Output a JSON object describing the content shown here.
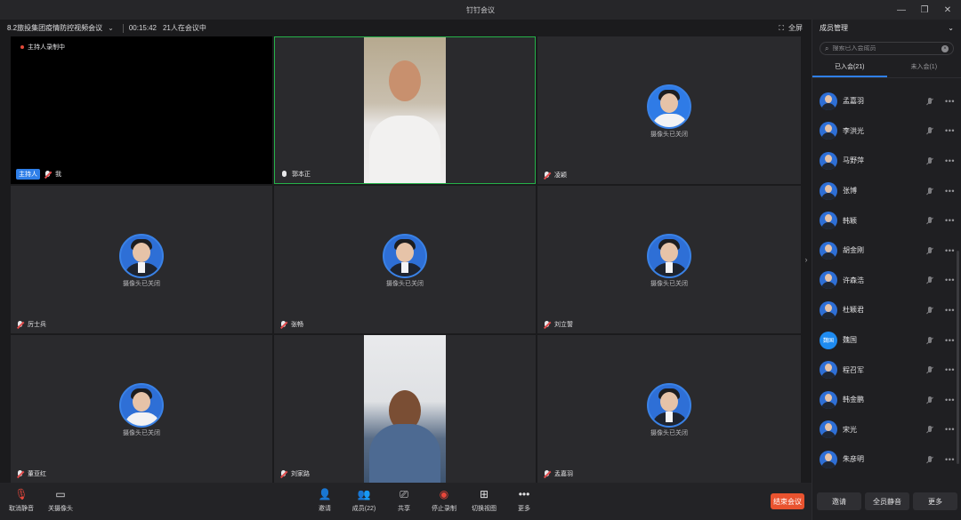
{
  "window": {
    "title": "钉钉会议"
  },
  "meeting": {
    "title": "8.2旅投集团疫情防控视频会议",
    "timer": "00:15:42",
    "count": "21人在会议中",
    "fullscreen": "全屏"
  },
  "tiles": {
    "t1": {
      "rec": "主持人录制中",
      "host": "主持人",
      "name": "我"
    },
    "t2": {
      "name": "郭本正"
    },
    "t3": {
      "name": "凌颖",
      "status": "摄像头已关闭"
    },
    "t4": {
      "name": "厉士兵",
      "status": "摄像头已关闭"
    },
    "t5": {
      "name": "张畅",
      "status": "摄像头已关闭"
    },
    "t6": {
      "name": "刘立誓",
      "status": "摄像头已关闭"
    },
    "t7": {
      "name": "董亚红",
      "status": "摄像头已关闭"
    },
    "t8": {
      "name": "刘家路"
    },
    "t9": {
      "name": "孟嘉羽",
      "status": "摄像头已关闭"
    }
  },
  "toolbar": {
    "unmute": "取消静音",
    "camera": "关摄像头",
    "invite": "邀请",
    "members": "成员(22)",
    "share": "共享",
    "stop_record": "停止录制",
    "switch_view": "切换视图",
    "more": "更多",
    "end": "结束会议"
  },
  "panel": {
    "title": "成员管理",
    "search_placeholder": "搜索已入会成员",
    "tab_joined": "已入会(21)",
    "tab_not_joined": "未入会(1)",
    "members": [
      {
        "name": "孟嘉羽"
      },
      {
        "name": "李洪光"
      },
      {
        "name": "马野萍"
      },
      {
        "name": "张博"
      },
      {
        "name": "韩颖"
      },
      {
        "name": "胡金刚"
      },
      {
        "name": "许森浩"
      },
      {
        "name": "杜颖君"
      },
      {
        "name": "魏国",
        "avatar_text": "魏国"
      },
      {
        "name": "程召军"
      },
      {
        "name": "韩金鹏"
      },
      {
        "name": "宋光"
      },
      {
        "name": "朱彦明"
      }
    ],
    "foot_invite": "邀请",
    "foot_mute_all": "全员静音",
    "foot_more": "更多"
  }
}
